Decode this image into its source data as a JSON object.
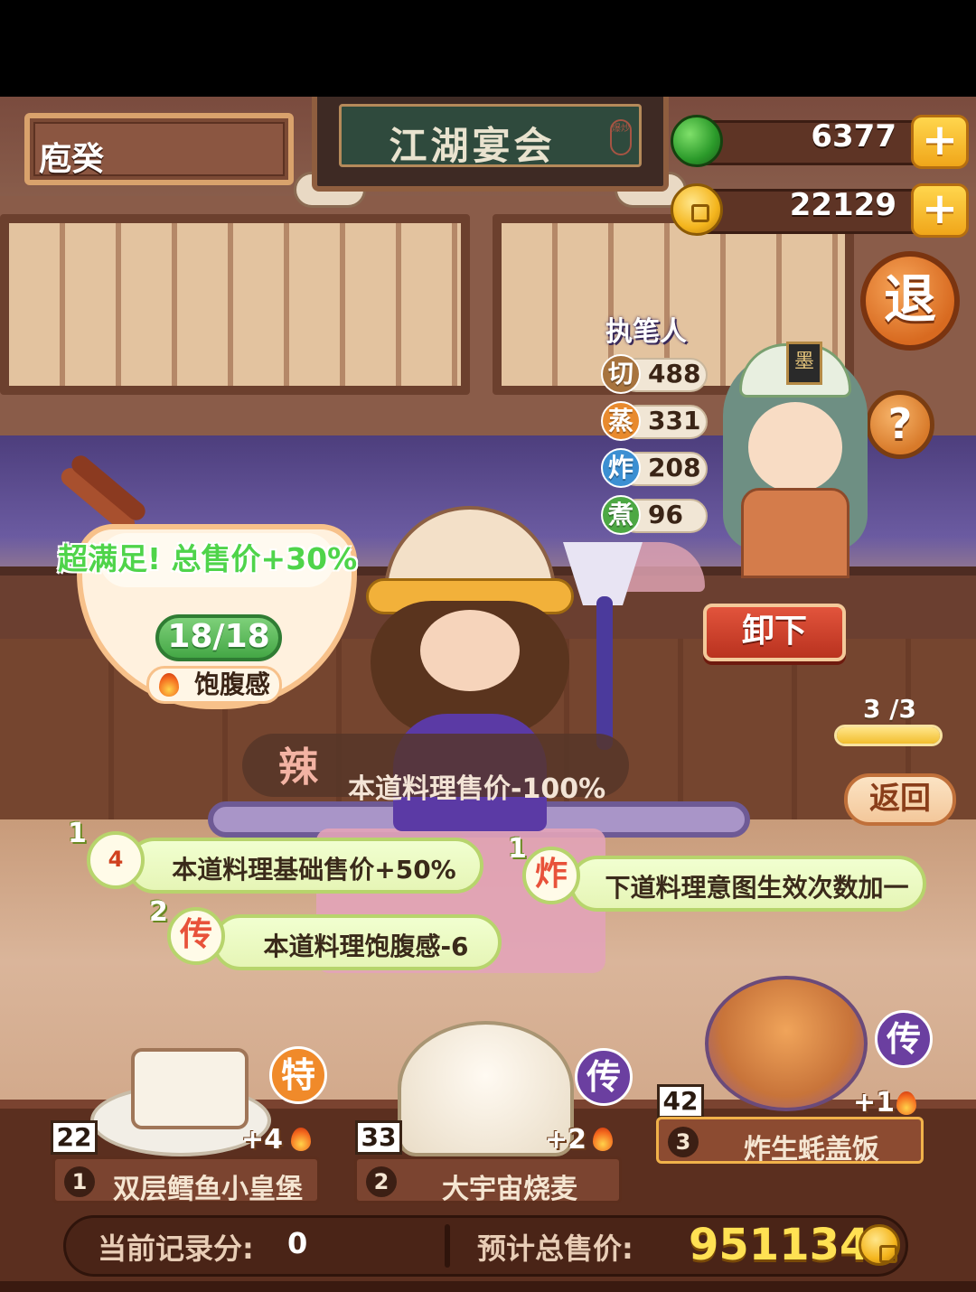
{
  "header": {
    "player_name": "庖癸",
    "title": "江湖宴会",
    "seal": "爆炒",
    "jade_amount": "6377",
    "coin_amount": "22129",
    "plus_symbol": "+",
    "exit_label": "退",
    "help_label": "?"
  },
  "writer": {
    "label": "执笔人",
    "ink_label": "墨",
    "stats": [
      {
        "icon": "切",
        "value": "488",
        "color": "#a7733e"
      },
      {
        "icon": "蒸",
        "value": "331",
        "color": "#e88a2e"
      },
      {
        "icon": "炸",
        "value": "208",
        "color": "#3c8fd2"
      },
      {
        "icon": "煮",
        "value": "96",
        "color": "#4da844"
      }
    ],
    "unload_label": "卸下"
  },
  "progress": {
    "label": "3  /3",
    "fraction": 1.0,
    "back_label": "返回"
  },
  "satiety": {
    "satisfied_text": "超满足!  总售价+30%",
    "value": "18/18",
    "label": "饱腹感"
  },
  "spicy": {
    "icon": "辣",
    "text": "本道料理售价-100%"
  },
  "effects": [
    {
      "num": "1",
      "tag": "4",
      "text": "本道料理基础售价+50%"
    },
    {
      "num": "2",
      "tag": "传",
      "text": "本道料理饱腹感-6"
    },
    {
      "num": "1",
      "tag": "炸",
      "text": "下道料理意图生效次数加一"
    }
  ],
  "dishes": [
    {
      "index": "1",
      "name": "双层鳕鱼小皇堡",
      "score": "22",
      "plus": "+4",
      "type": "特",
      "type_color": "#f08a2a",
      "selected": false
    },
    {
      "index": "2",
      "name": "大宇宙烧麦",
      "score": "33",
      "plus": "+2",
      "type": "传",
      "type_color": "#6b3fa0",
      "selected": false
    },
    {
      "index": "3",
      "name": "炸生蚝盖饭",
      "score": "42",
      "plus": "+1",
      "type": "传",
      "type_color": "#6b3fa0",
      "selected": true
    }
  ],
  "footer": {
    "record_label": "当前记录分:",
    "record_value": "0",
    "total_label": "预计总售价:",
    "total_value": "951134"
  }
}
